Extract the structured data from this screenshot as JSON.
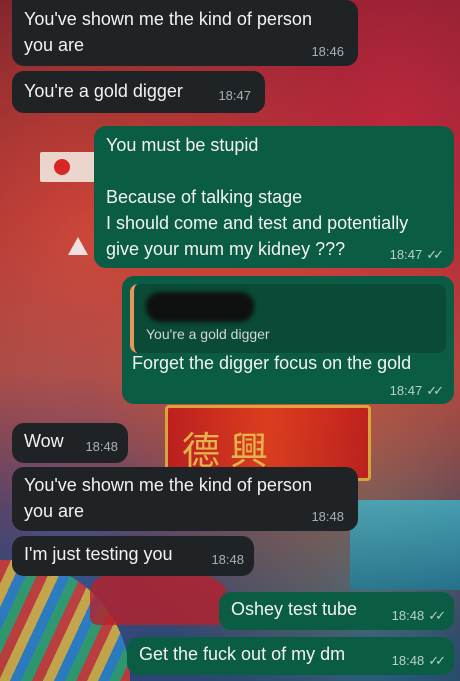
{
  "messages": [
    {
      "dir": "in",
      "lines": "You've shown me the kind of person\nyou are",
      "time": "18:46"
    },
    {
      "dir": "in",
      "lines": "You're a gold digger",
      "time": "18:47"
    },
    {
      "dir": "out",
      "lines": "You must be stupid\n\nBecause of talking stage\nI should come and test and potentially\ngive your mum my kidney ???",
      "time": "18:47",
      "status": "read"
    },
    {
      "dir": "out",
      "quote": {
        "text": "You're a gold digger"
      },
      "lines": "Forget the digger focus on the gold",
      "time": "18:47",
      "status": "read"
    },
    {
      "dir": "in",
      "lines": "Wow",
      "time": "18:48"
    },
    {
      "dir": "in",
      "lines": "You've shown me the kind of person\nyou are",
      "time": "18:48"
    },
    {
      "dir": "in",
      "lines": "I'm just testing you",
      "time": "18:48"
    },
    {
      "dir": "out",
      "lines": "Oshey test tube",
      "time": "18:48",
      "status": "read"
    },
    {
      "dir": "out",
      "lines": "Get the fuck out of my dm",
      "time": "18:48",
      "status": "read"
    }
  ],
  "colors": {
    "incoming_bubble": "#1f2326",
    "outgoing_bubble": "#0b5c44",
    "quote_bar": "#e8965a"
  },
  "icons": {
    "read_receipt": "double-check-icon"
  }
}
